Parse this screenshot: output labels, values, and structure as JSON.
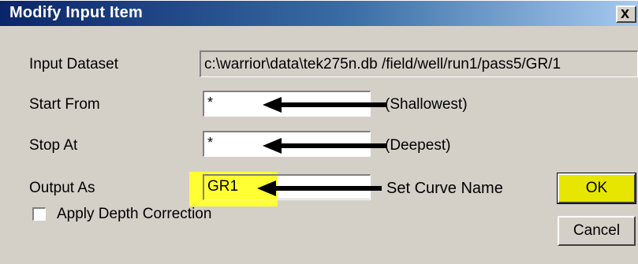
{
  "window": {
    "title": "Modify Input Item",
    "close_glyph": "x"
  },
  "fields": {
    "input_dataset": {
      "label": "Input Dataset",
      "value": "c:\\warrior\\data\\tek275n.db /field/well/run1/pass5/GR/1"
    },
    "start_from": {
      "label": "Start From",
      "value": "*",
      "annotation": "(Shallowest)"
    },
    "stop_at": {
      "label": "Stop At",
      "value": "*",
      "annotation": "(Deepest)"
    },
    "output_as": {
      "label": "Output As",
      "value": "GR1",
      "annotation": "Set Curve Name"
    }
  },
  "buttons": {
    "ok_label": "OK",
    "cancel_label": "Cancel"
  },
  "checkbox": {
    "label": "Apply Depth Correction",
    "checked": false
  },
  "colors": {
    "highlight": "#ffff33",
    "ok_button": "#e6e600",
    "titlebar_start": "#0a246a",
    "titlebar_end": "#a6caf0"
  }
}
